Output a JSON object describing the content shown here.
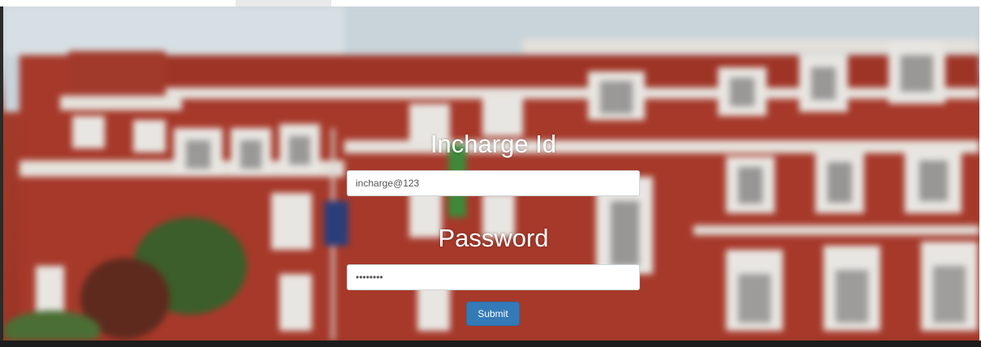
{
  "form": {
    "incharge_label": "Incharge Id",
    "incharge_value": "incharge@123",
    "password_label": "Password",
    "password_value": "password",
    "submit_label": "Submit"
  },
  "colors": {
    "button": "#337ab7",
    "building_red": "#a33b2a",
    "building_white": "#e8e6e2"
  }
}
